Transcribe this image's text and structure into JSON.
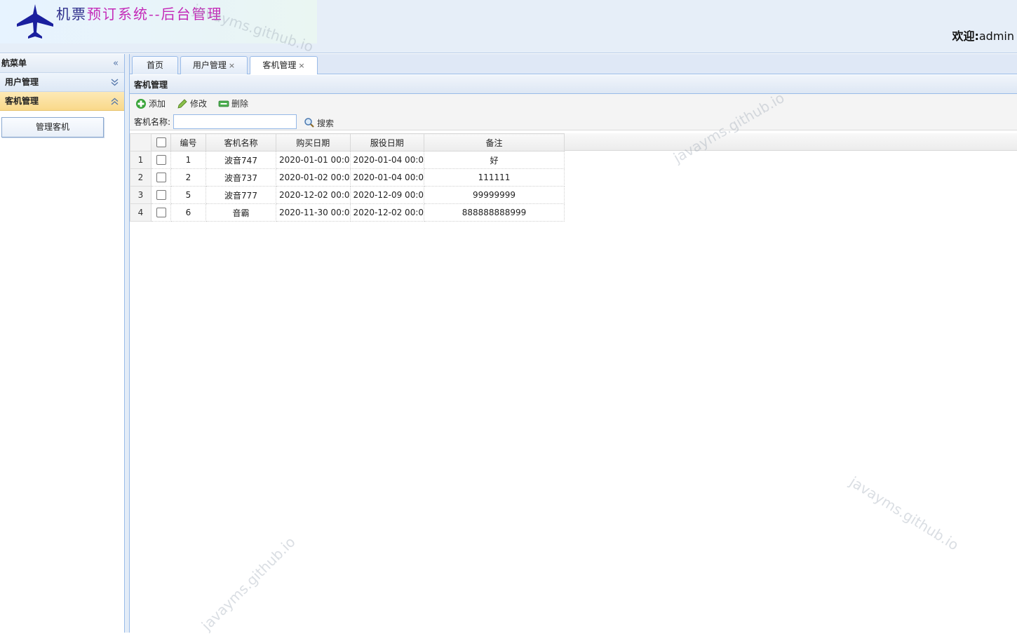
{
  "header": {
    "title_part1": "机票",
    "title_part2": "预订系统--后台管理",
    "welcome_label": "欢迎:",
    "username": "admin"
  },
  "sidebar": {
    "title": "航菜单",
    "collapse_icon": "double-chevron-left-icon",
    "groups": [
      {
        "label": "用户管理",
        "icon": "double-chevron-down-icon",
        "expanded": false
      },
      {
        "label": "客机管理",
        "icon": "double-chevron-up-icon",
        "expanded": true,
        "items": [
          "管理客机"
        ]
      }
    ]
  },
  "tabs": [
    {
      "label": "首页",
      "closable": false
    },
    {
      "label": "用户管理",
      "closable": true
    },
    {
      "label": "客机管理",
      "closable": true,
      "selected": true
    }
  ],
  "tab_close_glyph": "×",
  "panel": {
    "title": "客机管理",
    "toolbar": {
      "add_label": "添加",
      "edit_label": "修改",
      "delete_label": "删除"
    },
    "search": {
      "label": "客机名称:",
      "value": "",
      "button_label": "搜索"
    }
  },
  "grid": {
    "columns": [
      "编号",
      "客机名称",
      "购买日期",
      "服役日期",
      "备注"
    ],
    "rows": [
      {
        "rownum": "1",
        "id": "1",
        "name": "波音747",
        "buy_date": "2020-01-01 00:0",
        "service_date": "2020-01-04 00:0",
        "note": "好"
      },
      {
        "rownum": "2",
        "id": "2",
        "name": "波音737",
        "buy_date": "2020-01-02 00:0",
        "service_date": "2020-01-04 00:0",
        "note": "111111"
      },
      {
        "rownum": "3",
        "id": "5",
        "name": "波音777",
        "buy_date": "2020-12-02 00:0",
        "service_date": "2020-12-09 00:0",
        "note": "99999999"
      },
      {
        "rownum": "4",
        "id": "6",
        "name": "音霸",
        "buy_date": "2020-11-30 00:0",
        "service_date": "2020-12-02 00:0",
        "note": "888888888999"
      }
    ]
  },
  "watermark_text": "javayms.github.io",
  "colors": {
    "header_bg": "#e6eef8",
    "active_accordion": "#f9d98a",
    "border_blue": "#99bbe8",
    "title_purple": "#c42ab8",
    "title_navy": "#2c2c8a"
  }
}
